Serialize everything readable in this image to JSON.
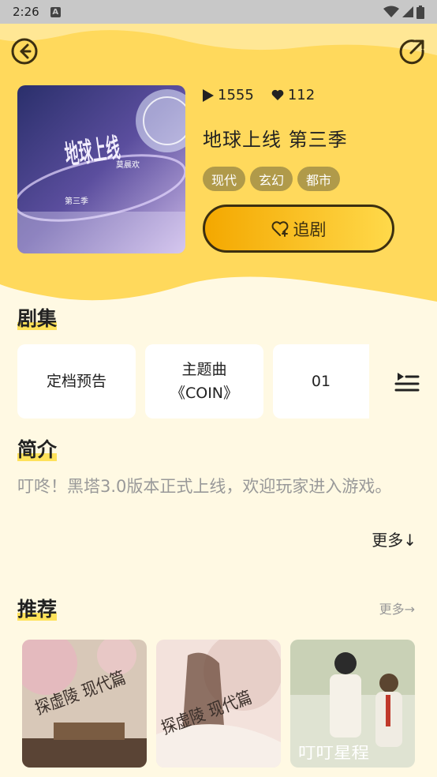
{
  "status_bar": {
    "time": "2:26",
    "indicator": "A"
  },
  "stats": {
    "plays": "1555",
    "likes": "112"
  },
  "drama": {
    "title": "地球上线 第三季",
    "tags": [
      "现代",
      "玄幻",
      "都市"
    ],
    "follow_label": "追剧"
  },
  "cover_text": {
    "main": "地球上线",
    "author": "莫晨欢",
    "season": "第三季"
  },
  "episodes": {
    "section_title": "剧集",
    "items": [
      {
        "label": "定档预告"
      },
      {
        "label": "主题曲\n《COIN》"
      },
      {
        "label": "01"
      }
    ]
  },
  "intro": {
    "section_title": "简介",
    "text": "叮咚！黑塔3.0版本正式上线，欢迎玩家进入游戏。",
    "more_label": "更多↓"
  },
  "recommend": {
    "section_title": "推荐",
    "more_label": "更多→",
    "items": [
      {
        "cover_text": "探虚陵 现代篇"
      },
      {
        "cover_text": "探虚陵 现代篇"
      },
      {
        "cover_text": "叮叮星程"
      }
    ]
  },
  "colors": {
    "accent": "#ffd94a",
    "hero_bg": "#ffd95c",
    "page_bg": "#fff9e3",
    "tag_bg": "#b09a4a"
  }
}
